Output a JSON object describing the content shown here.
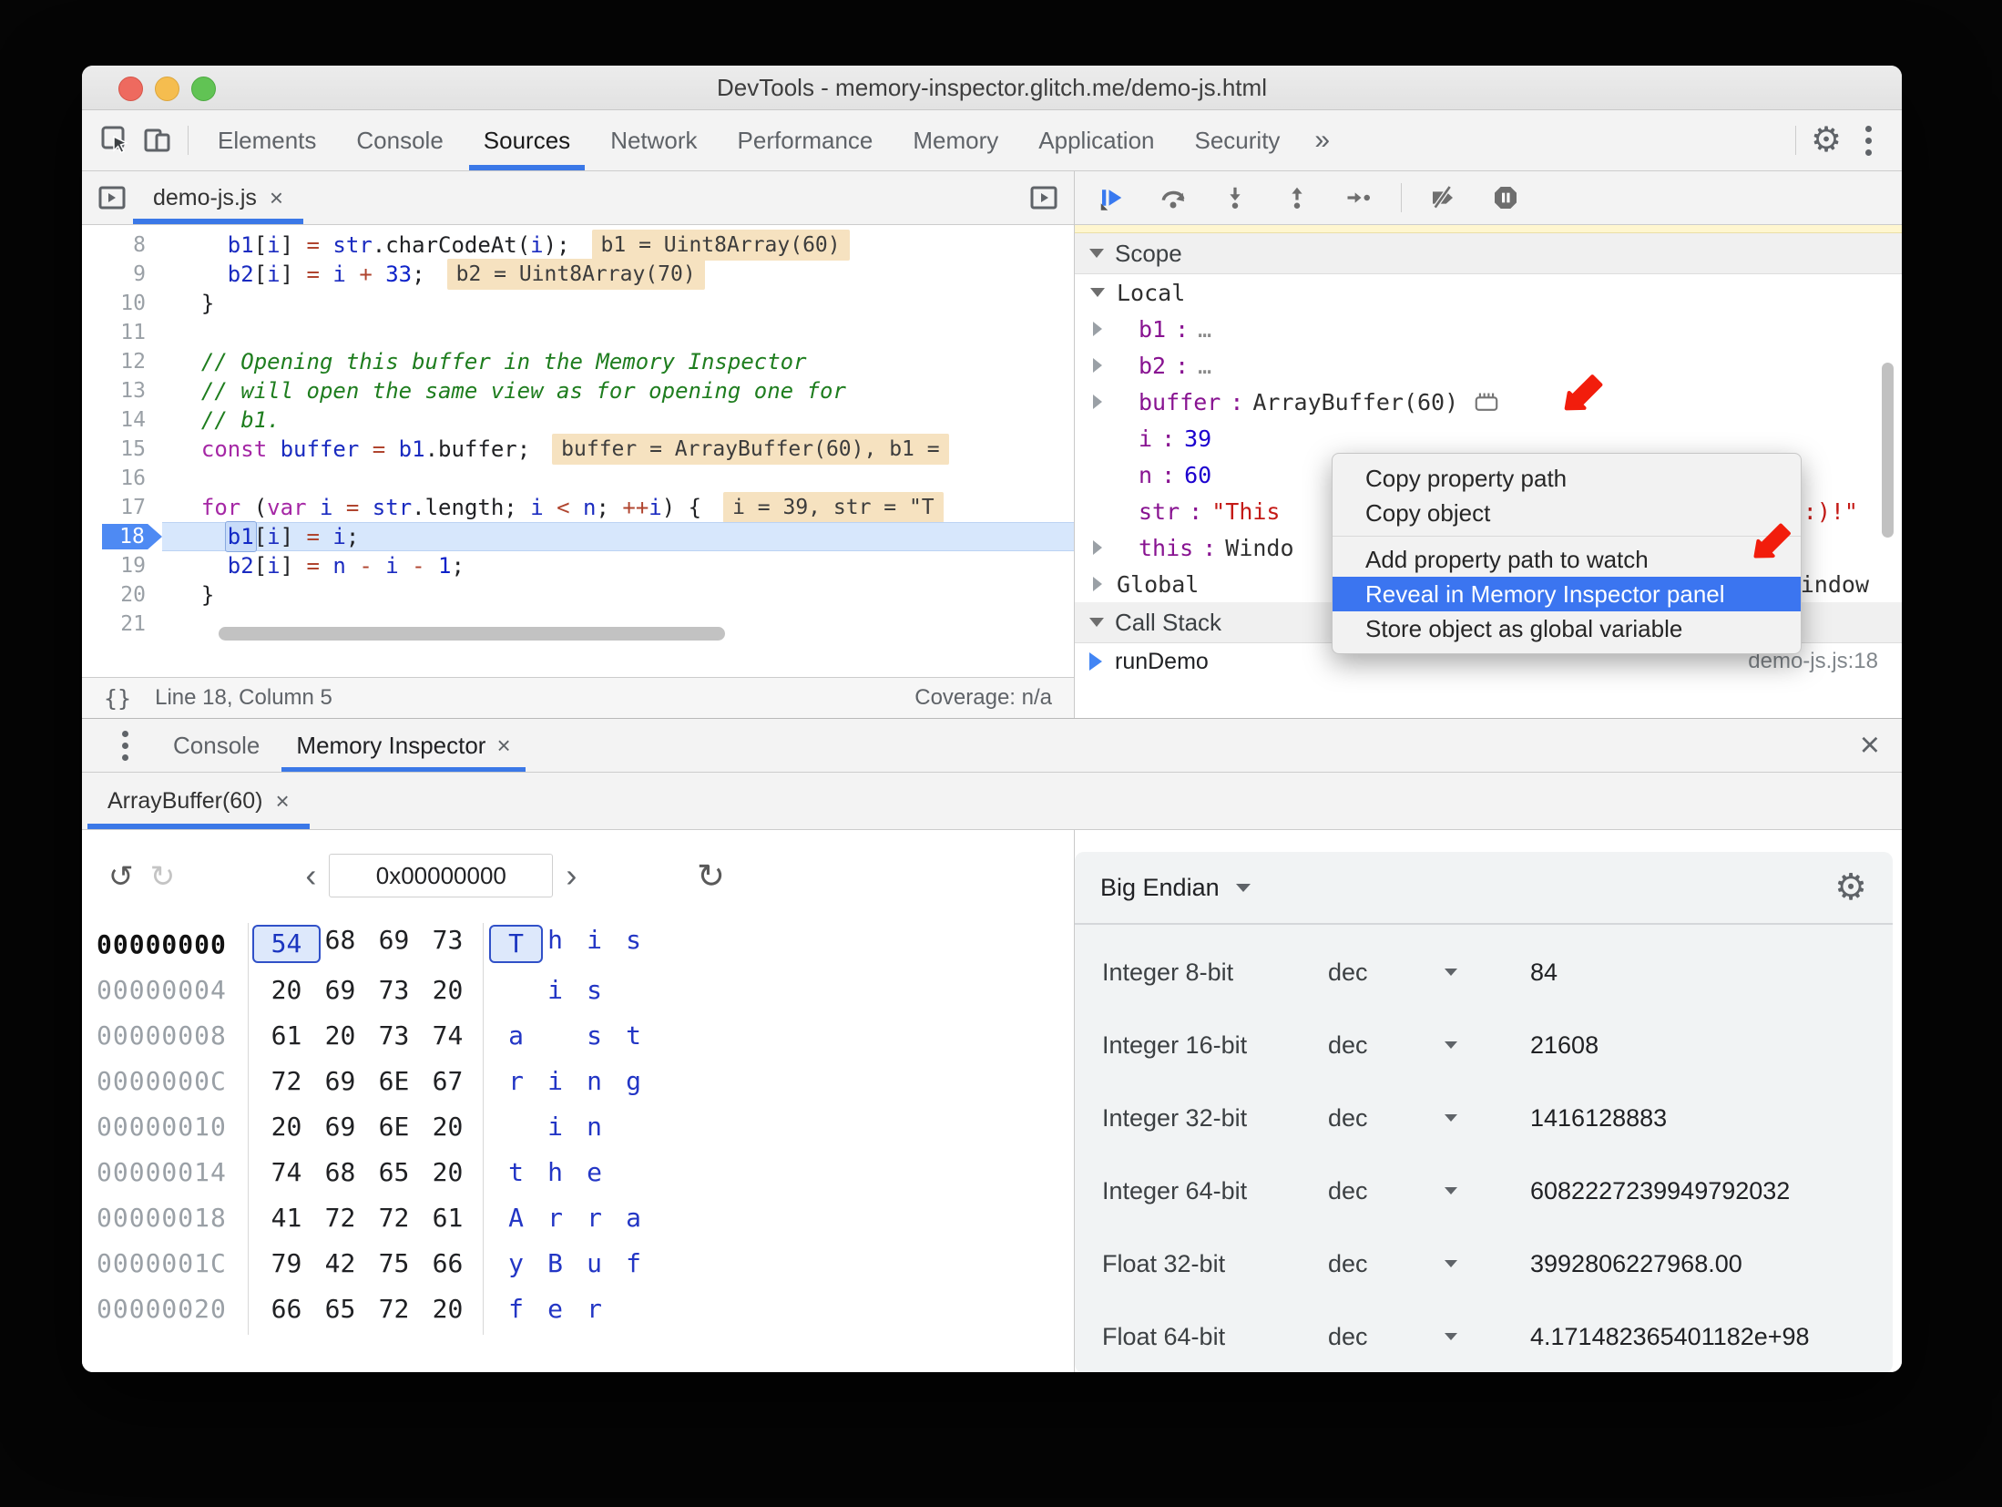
{
  "window_title": "DevTools - memory-inspector.glitch.me/demo-js.html",
  "main_tabs": {
    "items": [
      "Elements",
      "Console",
      "Sources",
      "Network",
      "Performance",
      "Memory",
      "Application",
      "Security"
    ],
    "active": "Sources",
    "overflow_chevron": "»"
  },
  "editor": {
    "file_tab": "demo-js.js",
    "close_glyph": "×",
    "lines": [
      {
        "n": 8,
        "seg": [
          [
            "p",
            "    "
          ],
          [
            "v",
            "b1"
          ],
          [
            "p",
            "["
          ],
          [
            "v",
            "i"
          ],
          [
            "p",
            "] "
          ],
          [
            "o",
            "="
          ],
          [
            "p",
            " "
          ],
          [
            "v",
            "str"
          ],
          [
            "p",
            ".charCodeAt("
          ],
          [
            "v",
            "i"
          ],
          [
            "p",
            ");"
          ]
        ],
        "hint": "b1 = Uint8Array(60)"
      },
      {
        "n": 9,
        "seg": [
          [
            "p",
            "    "
          ],
          [
            "v",
            "b2"
          ],
          [
            "p",
            "["
          ],
          [
            "v",
            "i"
          ],
          [
            "p",
            "] "
          ],
          [
            "o",
            "="
          ],
          [
            "p",
            " "
          ],
          [
            "v",
            "i"
          ],
          [
            "p",
            " "
          ],
          [
            "o",
            "+"
          ],
          [
            "p",
            " "
          ],
          [
            "n",
            "33"
          ],
          [
            "p",
            ";"
          ]
        ],
        "hint": "b2 = Uint8Array(70)"
      },
      {
        "n": 10,
        "seg": [
          [
            "p",
            "  }"
          ]
        ]
      },
      {
        "n": 11,
        "seg": []
      },
      {
        "n": 12,
        "seg": [
          [
            "c",
            "  // Opening this buffer in the Memory Inspector"
          ]
        ]
      },
      {
        "n": 13,
        "seg": [
          [
            "c",
            "  // will open the same view as for opening one for"
          ]
        ]
      },
      {
        "n": 14,
        "seg": [
          [
            "c",
            "  // b1."
          ]
        ]
      },
      {
        "n": 15,
        "seg": [
          [
            "p",
            "  "
          ],
          [
            "k",
            "const"
          ],
          [
            "p",
            " "
          ],
          [
            "v",
            "buffer"
          ],
          [
            "p",
            " "
          ],
          [
            "o",
            "="
          ],
          [
            "p",
            " "
          ],
          [
            "v",
            "b1"
          ],
          [
            "p",
            ".buffer;"
          ]
        ],
        "hint": "buffer = ArrayBuffer(60), b1 ="
      },
      {
        "n": 16,
        "seg": []
      },
      {
        "n": 17,
        "seg": [
          [
            "p",
            "  "
          ],
          [
            "k",
            "for"
          ],
          [
            "p",
            " ("
          ],
          [
            "k",
            "var"
          ],
          [
            "p",
            " "
          ],
          [
            "v",
            "i"
          ],
          [
            "p",
            " "
          ],
          [
            "o",
            "="
          ],
          [
            "p",
            " "
          ],
          [
            "v",
            "str"
          ],
          [
            "p",
            ".length; "
          ],
          [
            "v",
            "i"
          ],
          [
            "p",
            " "
          ],
          [
            "o",
            "<"
          ],
          [
            "p",
            " "
          ],
          [
            "v",
            "n"
          ],
          [
            "p",
            "; "
          ],
          [
            "o",
            "++"
          ],
          [
            "v",
            "i"
          ],
          [
            "p",
            ") {"
          ]
        ],
        "hint": "i = 39, str = \"T"
      },
      {
        "n": 18,
        "seg": [
          [
            "p",
            "    "
          ],
          [
            "sel",
            "b1"
          ],
          [
            "p",
            "["
          ],
          [
            "v",
            "i"
          ],
          [
            "p",
            "] "
          ],
          [
            "o",
            "="
          ],
          [
            "p",
            " "
          ],
          [
            "v",
            "i"
          ],
          [
            "p",
            ";"
          ]
        ],
        "current": true
      },
      {
        "n": 19,
        "seg": [
          [
            "p",
            "    "
          ],
          [
            "v",
            "b2"
          ],
          [
            "p",
            "["
          ],
          [
            "v",
            "i"
          ],
          [
            "p",
            "] "
          ],
          [
            "o",
            "="
          ],
          [
            "p",
            " "
          ],
          [
            "v",
            "n"
          ],
          [
            "p",
            " "
          ],
          [
            "o",
            "-"
          ],
          [
            "p",
            " "
          ],
          [
            "v",
            "i"
          ],
          [
            "p",
            " "
          ],
          [
            "o",
            "-"
          ],
          [
            "p",
            " "
          ],
          [
            "n",
            "1"
          ],
          [
            "p",
            ";"
          ]
        ]
      },
      {
        "n": 20,
        "seg": [
          [
            "p",
            "  }"
          ]
        ]
      },
      {
        "n": 21,
        "seg": []
      }
    ],
    "status": {
      "format_button": "{}",
      "position": "Line 18, Column 5",
      "coverage": "Coverage: n/a"
    }
  },
  "debugger": {
    "toolbar_icons": [
      "resume",
      "step-over",
      "step-into",
      "step-out",
      "step",
      "deactivate-breakpoints",
      "pause-on-exceptions"
    ],
    "scope": {
      "title": "Scope",
      "rows": [
        {
          "kind": "group",
          "expanded": true,
          "label": "Local"
        },
        {
          "kind": "prop",
          "exp": true,
          "name": "b1",
          "value": "…",
          "vt": "dim"
        },
        {
          "kind": "prop",
          "exp": true,
          "name": "b2",
          "value": "…",
          "vt": "dim"
        },
        {
          "kind": "prop",
          "exp": true,
          "name": "buffer",
          "value": "ArrayBuffer(60)",
          "vt": "obj",
          "icon": "memory"
        },
        {
          "kind": "prop",
          "exp": false,
          "name": "i",
          "value": "39",
          "vt": "num"
        },
        {
          "kind": "prop",
          "exp": false,
          "name": "n",
          "value": "60",
          "vt": "num"
        },
        {
          "kind": "prop",
          "exp": false,
          "name": "str",
          "value": "\"This",
          "vt": "str",
          "tail": ":)!\""
        },
        {
          "kind": "prop",
          "exp": true,
          "name": "this",
          "value": "Windo",
          "vt": "obj"
        },
        {
          "kind": "group",
          "expanded": false,
          "label": "Global",
          "right": "Window"
        }
      ]
    },
    "call_stack": {
      "title": "Call Stack",
      "frames": [
        {
          "name": "runDemo",
          "location": "demo-js.js:18"
        }
      ]
    }
  },
  "context_menu": {
    "items": [
      {
        "label": "Copy property path"
      },
      {
        "label": "Copy object"
      },
      {
        "sep": true
      },
      {
        "label": "Add property path to watch"
      },
      {
        "label": "Reveal in Memory Inspector panel",
        "highlighted": true
      },
      {
        "label": "Store object as global variable"
      }
    ]
  },
  "drawer": {
    "tabs": [
      {
        "label": "Console",
        "active": false,
        "closable": false
      },
      {
        "label": "Memory Inspector",
        "active": true,
        "closable": true
      }
    ],
    "close_glyph": "×"
  },
  "memory_inspector": {
    "buffer_tab": "ArrayBuffer(60)",
    "address_value": "0x00000000",
    "hex_rows": [
      {
        "addr": "00000000",
        "bytes": [
          "54",
          "68",
          "69",
          "73"
        ],
        "ascii": [
          "T",
          "h",
          "i",
          "s"
        ],
        "sel": 0,
        "first": true
      },
      {
        "addr": "00000004",
        "bytes": [
          "20",
          "69",
          "73",
          "20"
        ],
        "ascii": [
          "",
          "i",
          "s",
          ""
        ]
      },
      {
        "addr": "00000008",
        "bytes": [
          "61",
          "20",
          "73",
          "74"
        ],
        "ascii": [
          "a",
          "",
          "s",
          "t"
        ]
      },
      {
        "addr": "0000000C",
        "bytes": [
          "72",
          "69",
          "6E",
          "67"
        ],
        "ascii": [
          "r",
          "i",
          "n",
          "g"
        ]
      },
      {
        "addr": "00000010",
        "bytes": [
          "20",
          "69",
          "6E",
          "20"
        ],
        "ascii": [
          "",
          "i",
          "n",
          ""
        ]
      },
      {
        "addr": "00000014",
        "bytes": [
          "74",
          "68",
          "65",
          "20"
        ],
        "ascii": [
          "t",
          "h",
          "e",
          ""
        ]
      },
      {
        "addr": "00000018",
        "bytes": [
          "41",
          "72",
          "72",
          "61"
        ],
        "ascii": [
          "A",
          "r",
          "r",
          "a"
        ]
      },
      {
        "addr": "0000001C",
        "bytes": [
          "79",
          "42",
          "75",
          "66"
        ],
        "ascii": [
          "y",
          "B",
          "u",
          "f"
        ]
      },
      {
        "addr": "00000020",
        "bytes": [
          "66",
          "65",
          "72",
          "20"
        ],
        "ascii": [
          "f",
          "e",
          "r",
          ""
        ]
      }
    ],
    "values": {
      "endianness": "Big Endian",
      "rows": [
        {
          "label": "Integer 8-bit",
          "format": "dec",
          "value": "84"
        },
        {
          "label": "Integer 16-bit",
          "format": "dec",
          "value": "21608"
        },
        {
          "label": "Integer 32-bit",
          "format": "dec",
          "value": "1416128883"
        },
        {
          "label": "Integer 64-bit",
          "format": "dec",
          "value": "6082227239949792032"
        },
        {
          "label": "Float 32-bit",
          "format": "dec",
          "value": "3992806227968.00"
        },
        {
          "label": "Float 64-bit",
          "format": "dec",
          "value": "4.171482365401182e+98"
        }
      ]
    }
  },
  "colors": {
    "accent_blue": "#3b78e7",
    "menu_highlight": "#3b75f0",
    "arrow_red": "#f21d0c",
    "exec_line_bg": "#d7e7fc",
    "hint_bg": "#f6e2c0",
    "property_purple": "#881391",
    "number_blue": "#1c00cf",
    "string_red": "#c41a16",
    "keyword_purple": "#a527a5",
    "comment_green": "#1e7d1e",
    "operator_brown": "#b0452f"
  }
}
